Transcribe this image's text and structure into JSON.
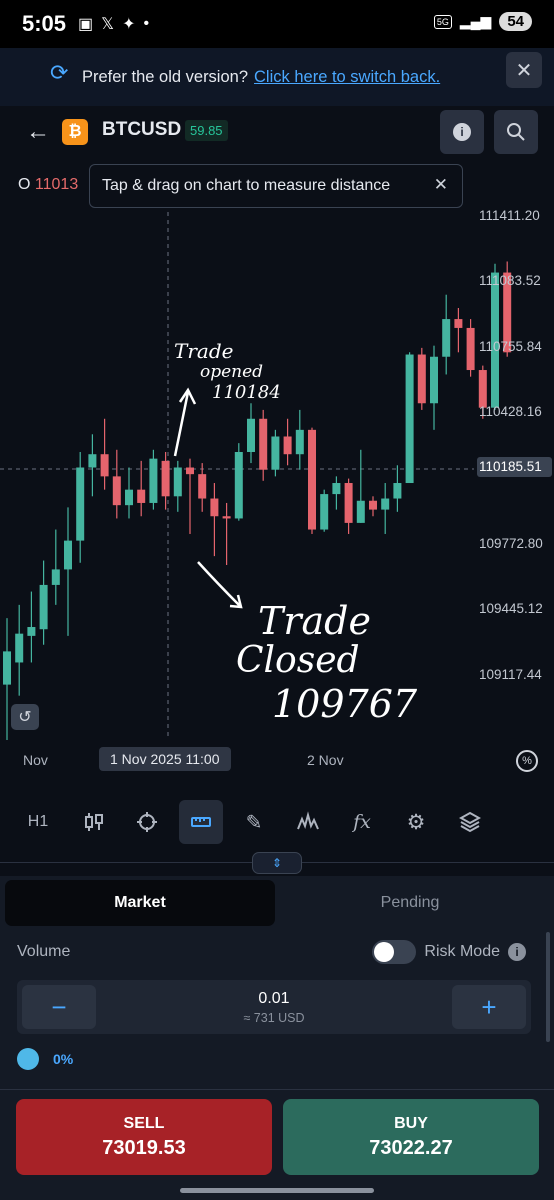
{
  "status": {
    "time": "5:05",
    "battery": "54",
    "network": "5G"
  },
  "banner": {
    "text": "Prefer the old version?",
    "link": "Click here to switch back."
  },
  "header": {
    "symbol": "BTCUSD",
    "change": "59.85",
    "coin_letter": "₿"
  },
  "ohlc": {
    "label": "O",
    "value": "11013"
  },
  "tooltip": {
    "text": "Tap & drag on chart to measure distance"
  },
  "price_axis": [
    "111411.20",
    "111083.52",
    "110755.84",
    "110428.16",
    "110185.51",
    "109772.80",
    "109445.12",
    "109117.44"
  ],
  "annotations": {
    "opened": [
      "Trade",
      "opened",
      "110184"
    ],
    "closed": [
      "Trade",
      "Closed",
      "109767"
    ]
  },
  "time_axis": {
    "left": "Nov",
    "selected": "1 Nov 2025 11:00",
    "right": "2 Nov"
  },
  "chart_data": {
    "type": "candlestick",
    "current_price": 110185.51,
    "ylim": [
      108950,
      111550
    ],
    "colors": {
      "up": "#45b5a0",
      "down": "#e5646d"
    },
    "candles": [
      {
        "o": 109200,
        "c": 109350,
        "h": 109500,
        "l": 108950
      },
      {
        "o": 109300,
        "c": 109430,
        "h": 109560,
        "l": 109150
      },
      {
        "o": 109420,
        "c": 109460,
        "h": 109620,
        "l": 109300
      },
      {
        "o": 109450,
        "c": 109650,
        "h": 109760,
        "l": 109380
      },
      {
        "o": 109650,
        "c": 109720,
        "h": 109900,
        "l": 109560
      },
      {
        "o": 109720,
        "c": 109850,
        "h": 110000,
        "l": 109420
      },
      {
        "o": 109850,
        "c": 110180,
        "h": 110250,
        "l": 109750
      },
      {
        "o": 110180,
        "c": 110240,
        "h": 110330,
        "l": 110050
      },
      {
        "o": 110240,
        "c": 110140,
        "h": 110400,
        "l": 110080
      },
      {
        "o": 110140,
        "c": 110010,
        "h": 110260,
        "l": 109950
      },
      {
        "o": 110010,
        "c": 110080,
        "h": 110180,
        "l": 109950
      },
      {
        "o": 110080,
        "c": 110020,
        "h": 110210,
        "l": 109960
      },
      {
        "o": 110020,
        "c": 110220,
        "h": 110260,
        "l": 109990
      },
      {
        "o": 110210,
        "c": 110050,
        "h": 110250,
        "l": 109990
      },
      {
        "o": 110050,
        "c": 110180,
        "h": 110210,
        "l": 109980
      },
      {
        "o": 110180,
        "c": 110150,
        "h": 110220,
        "l": 109880
      },
      {
        "o": 110150,
        "c": 110040,
        "h": 110200,
        "l": 109980
      },
      {
        "o": 110040,
        "c": 109960,
        "h": 110110,
        "l": 109780
      },
      {
        "o": 109960,
        "c": 109950,
        "h": 110020,
        "l": 109740
      },
      {
        "o": 109950,
        "c": 110250,
        "h": 110290,
        "l": 109940
      },
      {
        "o": 110250,
        "c": 110400,
        "h": 110470,
        "l": 110200
      },
      {
        "o": 110400,
        "c": 110170,
        "h": 110440,
        "l": 110120
      },
      {
        "o": 110170,
        "c": 110320,
        "h": 110350,
        "l": 110140
      },
      {
        "o": 110320,
        "c": 110240,
        "h": 110400,
        "l": 110190
      },
      {
        "o": 110240,
        "c": 110350,
        "h": 110440,
        "l": 110170
      },
      {
        "o": 110350,
        "c": 109900,
        "h": 110360,
        "l": 109880
      },
      {
        "o": 109900,
        "c": 110060,
        "h": 110080,
        "l": 109890
      },
      {
        "o": 110060,
        "c": 110110,
        "h": 110140,
        "l": 109990
      },
      {
        "o": 110110,
        "c": 109930,
        "h": 110130,
        "l": 109880
      },
      {
        "o": 109930,
        "c": 110030,
        "h": 110260,
        "l": 109930
      },
      {
        "o": 110030,
        "c": 109990,
        "h": 110050,
        "l": 109960
      },
      {
        "o": 109990,
        "c": 110040,
        "h": 110110,
        "l": 109880
      },
      {
        "o": 110040,
        "c": 110110,
        "h": 110190,
        "l": 109980
      },
      {
        "o": 110110,
        "c": 110690,
        "h": 110700,
        "l": 110110
      },
      {
        "o": 110690,
        "c": 110470,
        "h": 110720,
        "l": 110440
      },
      {
        "o": 110470,
        "c": 110680,
        "h": 110730,
        "l": 110350
      },
      {
        "o": 110680,
        "c": 110850,
        "h": 110960,
        "l": 110600
      },
      {
        "o": 110850,
        "c": 110810,
        "h": 110900,
        "l": 110700
      },
      {
        "o": 110810,
        "c": 110620,
        "h": 110850,
        "l": 110590
      },
      {
        "o": 110620,
        "c": 110450,
        "h": 110640,
        "l": 110400
      },
      {
        "o": 110450,
        "c": 111060,
        "h": 111100,
        "l": 110440
      },
      {
        "o": 111060,
        "c": 110700,
        "h": 111110,
        "l": 110680
      }
    ]
  },
  "toolbar": {
    "timeframe": "H1"
  },
  "order": {
    "tab_market": "Market",
    "tab_pending": "Pending",
    "volume_label": "Volume",
    "risk_label": "Risk Mode",
    "volume_value": "0.01",
    "volume_usd": "≈ 731 USD",
    "percent": "0%",
    "sell_label": "SELL",
    "sell_price": "73019.53",
    "buy_label": "BUY",
    "buy_price": "73022.27"
  }
}
